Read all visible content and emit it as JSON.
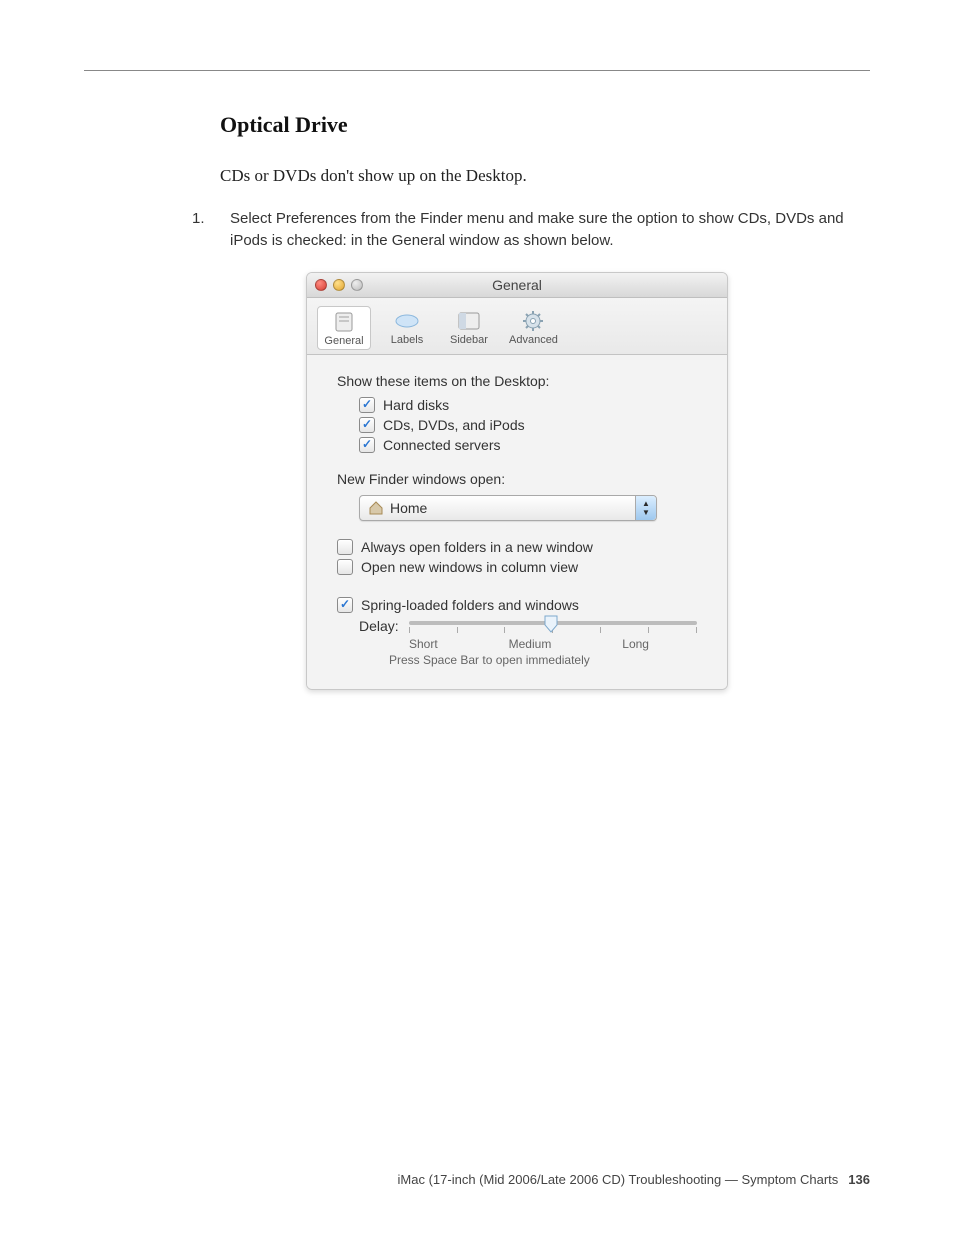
{
  "section_title": "Optical Drive",
  "symptom_line": "CDs or DVDs don't show up on the Desktop.",
  "step": {
    "num": "1.",
    "text": "Select Preferences from the Finder menu and make sure the option to show CDs, DVDs and iPods is checked: in the General window as shown below."
  },
  "prefs": {
    "window_title": "General",
    "tabs": {
      "general": "General",
      "labels": "Labels",
      "sidebar": "Sidebar",
      "advanced": "Advanced"
    },
    "show_items_heading": "Show these items on the Desktop:",
    "checks": {
      "hard_disks": "Hard disks",
      "cds": "CDs, DVDs, and iPods",
      "servers": "Connected servers",
      "new_window": "Always open folders in a new window",
      "column_view": "Open new windows in column view",
      "spring": "Spring-loaded folders and windows"
    },
    "new_windows_heading": "New Finder windows open:",
    "popup_label": "Home",
    "delay_label": "Delay:",
    "slider": {
      "short": "Short",
      "medium": "Medium",
      "long": "Long"
    },
    "spacebar_hint": "Press Space Bar to open immediately"
  },
  "footer": {
    "text": "iMac (17-inch (Mid 2006/Late 2006 CD) Troubleshooting — Symptom Charts",
    "page": "136"
  }
}
